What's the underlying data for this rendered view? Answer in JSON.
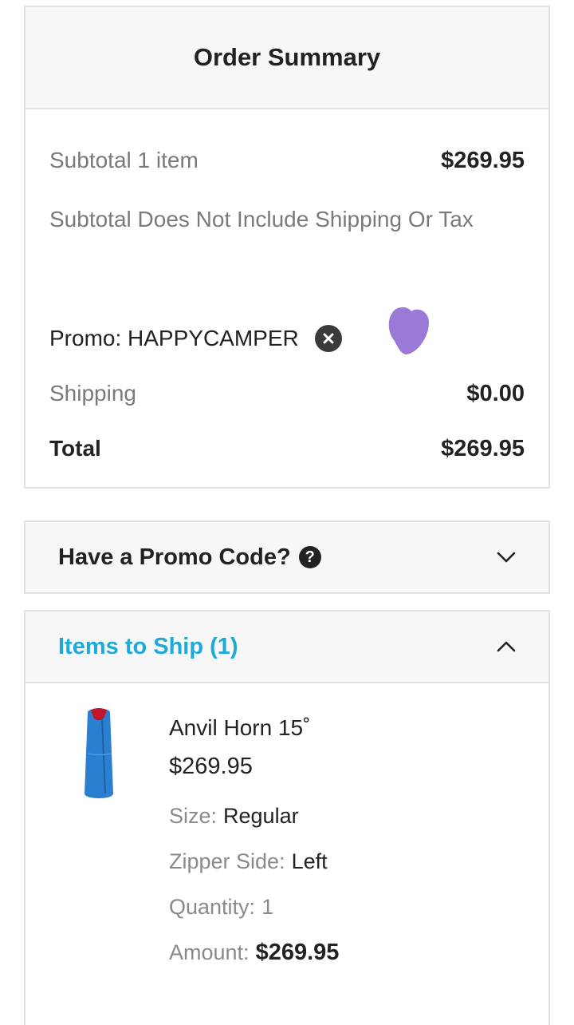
{
  "summary": {
    "title": "Order Summary",
    "subtotal_label": "Subtotal 1 item",
    "subtotal_value": "$269.95",
    "note": "Subtotal Does Not Include Shipping Or Tax",
    "promo_label": "Promo: HAPPYCAMPER",
    "shipping_label": "Shipping",
    "shipping_value": "$0.00",
    "total_label": "Total",
    "total_value": "$269.95"
  },
  "promo_code": {
    "title": "Have a Promo Code?",
    "help_glyph": "?"
  },
  "items_to_ship": {
    "title": "Items to Ship (1)",
    "product": {
      "name": "Anvil Horn 15˚",
      "price": "$269.95",
      "size_label": "Size:",
      "size_value": "Regular",
      "zipper_label": "Zipper Side:",
      "zipper_value": "Left",
      "quantity_label": "Quantity:",
      "quantity_value": "1",
      "amount_label": "Amount:",
      "amount_value": "$269.95"
    }
  },
  "colors": {
    "accent": "#1fa9d6",
    "header_bg": "#f7f7f7",
    "border": "#e2e2e2",
    "product_blue": "#2a7fd0",
    "blob": "#9a7ad6"
  },
  "icons": [
    "close-circle-icon",
    "help-circle-icon",
    "chevron-down-icon",
    "chevron-up-icon"
  ]
}
